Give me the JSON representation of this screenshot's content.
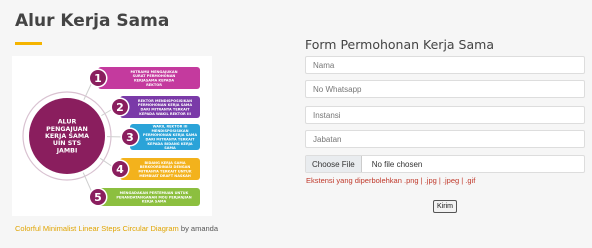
{
  "header": {
    "title": "Alur Kerja Sama"
  },
  "diagram": {
    "center_lines": [
      "ALUR",
      "PENGAJUAN",
      "KERJA SAMA",
      "UIN STS",
      "JAMBI"
    ],
    "steps": [
      {
        "number": "1",
        "color": "#c43a9e",
        "lines": [
          "MITRAMU MENGAJUKAN",
          "SURAT PERMOHONAN",
          "KERJASAMA KEPADA",
          "REKTOR"
        ]
      },
      {
        "number": "2",
        "color": "#7a3aa8",
        "lines": [
          "REKTOR MENDISPOSISIKAN",
          "PERMOHONAN KERJA SAMA",
          "DARI MITRANYA TERKAIT",
          "KEPADA WAKIL REKTOR III"
        ]
      },
      {
        "number": "3",
        "color": "#2aa3d8",
        "lines": [
          "WAKIL REKTOR III",
          "MENDISPOSISIKAN",
          "PERMOHONAN KERJA SAMA",
          "DARI MITRANYA TERKAIT",
          "KEPADA BIDANG KERJA",
          "SAMA"
        ]
      },
      {
        "number": "4",
        "color": "#f3b21c",
        "lines": [
          "BIDANG KERJA SAMA",
          "BERKOORDINASI DENGAN",
          "MITRANYA TERKAIT UNTUK",
          "MEMBUAT DRAFT NASKAH"
        ]
      },
      {
        "number": "5",
        "color": "#8cbf3f",
        "lines": [
          "MENGADAKAN PERTEMUAN UNTUK",
          "PENANDATANGANAN MOU PERJANJIAN",
          "KERJA SAMA"
        ]
      }
    ]
  },
  "caption": {
    "link_text": "Colorful Minimalist Linear Steps Circular Diagram",
    "suffix": " by amanda"
  },
  "form": {
    "title": "Form Permohonan Kerja Sama",
    "fields": [
      {
        "placeholder": "Nama"
      },
      {
        "placeholder": "No Whatsapp"
      },
      {
        "placeholder": "Instansi"
      },
      {
        "placeholder": "Jabatan"
      }
    ],
    "file_button": "Choose File",
    "file_status": "No file chosen",
    "extension_note": "Ekstensi yang diperbolehkan .png | .jpg | .jpeg | .gif",
    "submit_label": "Kirim"
  },
  "colors": {
    "accent": "#f5b400",
    "center": "#8a1e5e",
    "error": "#c0392b"
  }
}
